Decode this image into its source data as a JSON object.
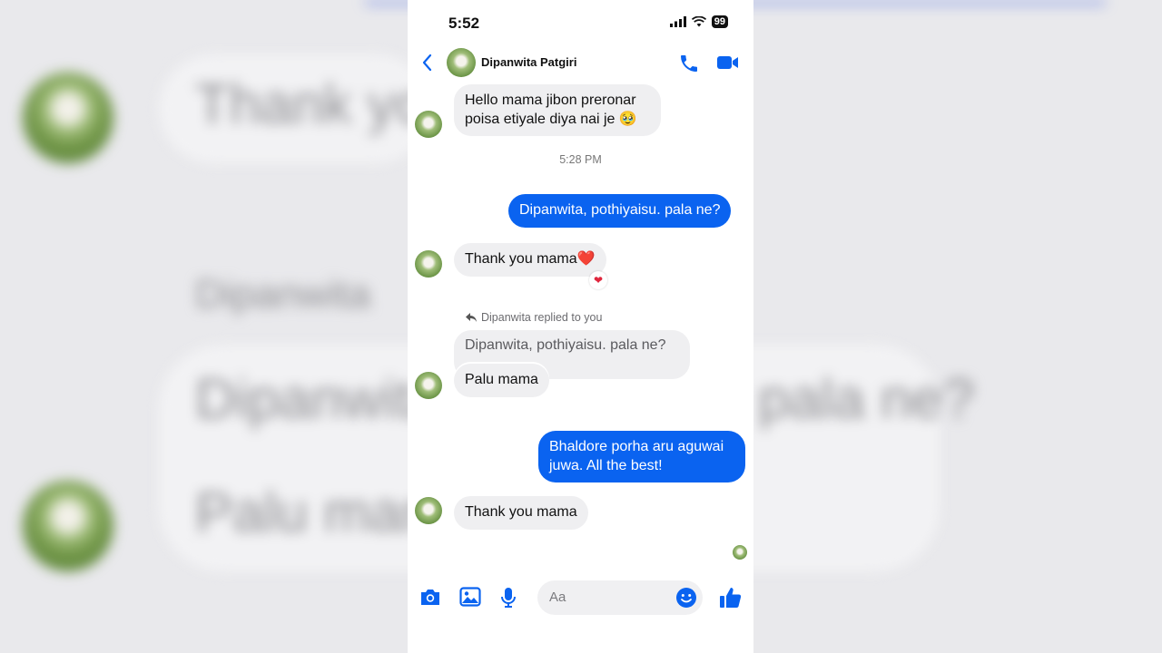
{
  "status_bar": {
    "time": "5:52",
    "battery": "99"
  },
  "header": {
    "contact_name": "Dipanwita Patgiri"
  },
  "messages": [
    {
      "dir": "in",
      "text": "Hello mama jibon preronar poisa etiyale diya nai je 🥹"
    },
    {
      "dir": "time",
      "text": "5:28 PM"
    },
    {
      "dir": "out",
      "text": "Dipanwita, pothiyaisu. pala ne?"
    },
    {
      "dir": "in",
      "text": "Thank you mama❤️",
      "reaction": "❤"
    },
    {
      "dir": "note",
      "text": "Dipanwita replied to you"
    },
    {
      "dir": "quote",
      "text": "Dipanwita, pothiyaisu. pala ne?"
    },
    {
      "dir": "in",
      "text": "Palu mama"
    },
    {
      "dir": "out",
      "text": "Bhaldore porha aru aguwai juwa. All the best!"
    },
    {
      "dir": "in",
      "text": "Thank you mama"
    }
  ],
  "composer": {
    "placeholder": "Aa"
  },
  "background": {
    "line1": "Thank you",
    "line2": "Dipanwita",
    "line3": "Dipanwita, pothiyaisu. pala ne?",
    "line4": "Palu mama"
  },
  "colors": {
    "accent": "#0a63f0",
    "incoming_bubble": "#efeff1"
  }
}
